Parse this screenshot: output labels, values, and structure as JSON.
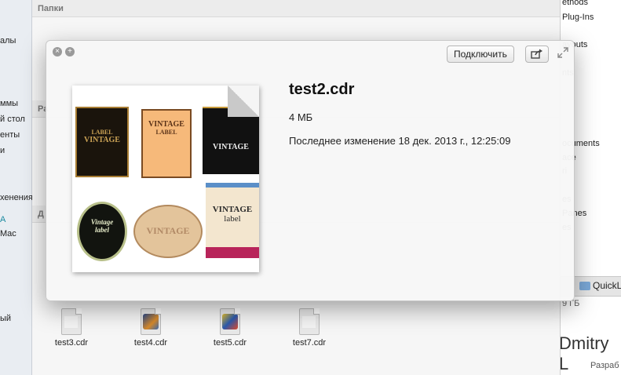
{
  "left_sidebar": {
    "items": [
      "алы",
      "ммы",
      "й стол",
      "енты",
      "и",
      "хенения",
      "A",
      "Mac",
      "ый"
    ]
  },
  "finder": {
    "section_folders": "Папки",
    "section_docs_partial": "Ра",
    "section_other_partial": "Д",
    "bottom_files": [
      "test3.cdr",
      "test4.cdr",
      "test5.cdr",
      "test7.cdr"
    ]
  },
  "right_panel": {
    "lines": [
      "ethods",
      "Plug-Ins",
      "ayouts",
      "nts",
      "ocuments",
      "ace",
      "ri",
      "es",
      "Panes",
      "es"
    ],
    "path_item": "QuickL",
    "storage_partial": "9 ГБ",
    "name_big": "Dmitry L",
    "role": "Разраб"
  },
  "quicklook": {
    "open_button": "Подключить",
    "share_icon": "share-icon",
    "close_icon": "close-icon",
    "fullscreen_icon": "fullscreen-icon",
    "expand_icon": "expand-icon",
    "filename": "test2.cdr",
    "size": "4 МБ",
    "modified": "Последнее изменение 18 дек. 2013 г., 12:25:09",
    "thumb_labels": [
      "VINTAGE",
      "LABEL",
      "VINTAGE",
      "LABEL",
      "VINTAGE",
      "Vintage",
      "label",
      "VINTAGE",
      "VINTAGE",
      "label"
    ]
  },
  "colors": {
    "teal_text": "#1b8aa0",
    "overlay_bg": "#f7f7f7"
  }
}
